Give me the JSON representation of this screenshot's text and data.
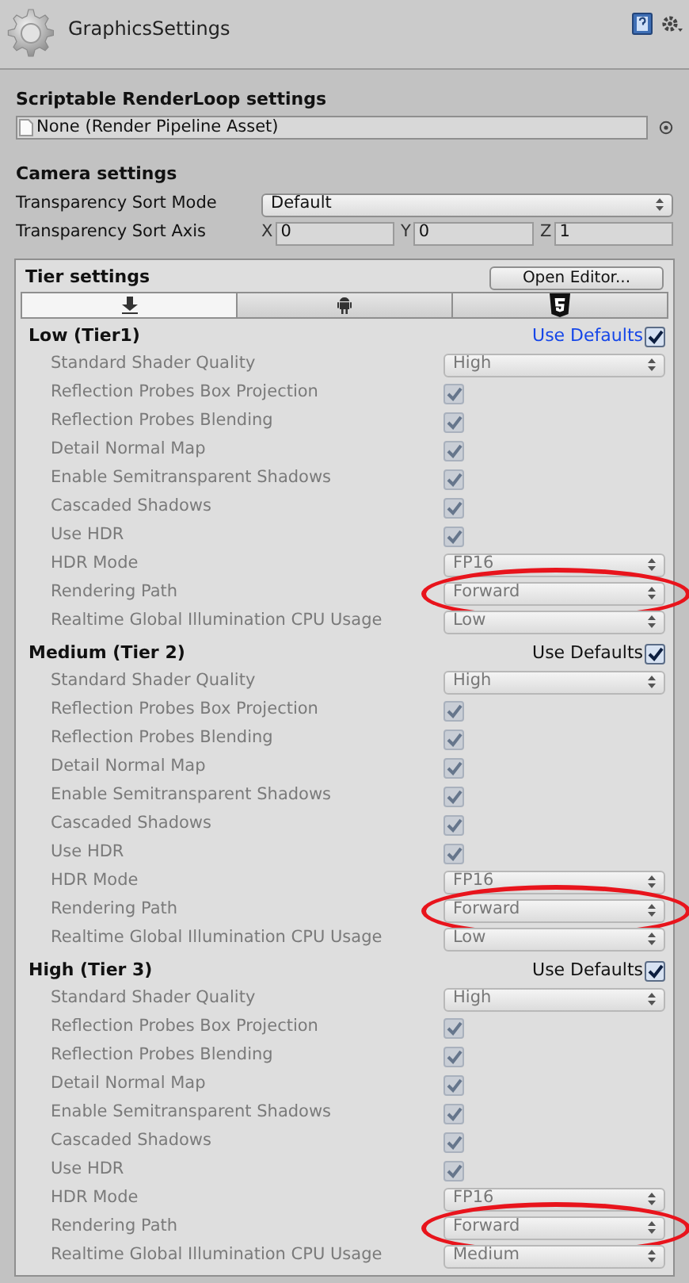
{
  "header": {
    "title": "GraphicsSettings"
  },
  "scriptable": {
    "heading": "Scriptable RenderLoop settings",
    "field": "None (Render Pipeline Asset)"
  },
  "camera": {
    "heading": "Camera settings",
    "sort_mode": {
      "label": "Transparency Sort Mode",
      "value": "Default"
    },
    "sort_axis": {
      "label": "Transparency Sort Axis",
      "axes": [
        {
          "label": "X",
          "value": "0"
        },
        {
          "label": "Y",
          "value": "0"
        },
        {
          "label": "Z",
          "value": "1"
        }
      ]
    }
  },
  "tier_settings": {
    "heading": "Tier settings",
    "button": "Open Editor...",
    "tabs": [
      {
        "kind": "download",
        "selected": true
      },
      {
        "kind": "android",
        "selected": false
      },
      {
        "kind": "html5",
        "selected": false
      }
    ],
    "tiers": [
      {
        "name": "Low (Tier1)",
        "defaults_label": "Use Defaults",
        "use_defaults": true,
        "highlighted": true,
        "settings": [
          {
            "kind": "dropdown",
            "label": "Standard Shader Quality",
            "value": "High",
            "circled": false
          },
          {
            "kind": "checkbox",
            "label": "Reflection Probes Box Projection",
            "checked": true
          },
          {
            "kind": "checkbox",
            "label": "Reflection Probes Blending",
            "checked": true
          },
          {
            "kind": "checkbox",
            "label": "Detail Normal Map",
            "checked": true
          },
          {
            "kind": "checkbox",
            "label": "Enable Semitransparent Shadows",
            "checked": true
          },
          {
            "kind": "checkbox",
            "label": "Cascaded Shadows",
            "checked": true
          },
          {
            "kind": "checkbox",
            "label": "Use HDR",
            "checked": true
          },
          {
            "kind": "dropdown",
            "label": "HDR Mode",
            "value": "FP16",
            "circled": false
          },
          {
            "kind": "dropdown",
            "label": "Rendering Path",
            "value": "Forward",
            "circled": true
          },
          {
            "kind": "dropdown",
            "label": "Realtime Global Illumination CPU Usage",
            "value": "Low",
            "circled": false
          }
        ]
      },
      {
        "name": "Medium (Tier 2)",
        "defaults_label": "Use Defaults",
        "use_defaults": true,
        "highlighted": false,
        "settings": [
          {
            "kind": "dropdown",
            "label": "Standard Shader Quality",
            "value": "High",
            "circled": false
          },
          {
            "kind": "checkbox",
            "label": "Reflection Probes Box Projection",
            "checked": true
          },
          {
            "kind": "checkbox",
            "label": "Reflection Probes Blending",
            "checked": true
          },
          {
            "kind": "checkbox",
            "label": "Detail Normal Map",
            "checked": true
          },
          {
            "kind": "checkbox",
            "label": "Enable Semitransparent Shadows",
            "checked": true
          },
          {
            "kind": "checkbox",
            "label": "Cascaded Shadows",
            "checked": true
          },
          {
            "kind": "checkbox",
            "label": "Use HDR",
            "checked": true
          },
          {
            "kind": "dropdown",
            "label": "HDR Mode",
            "value": "FP16",
            "circled": false
          },
          {
            "kind": "dropdown",
            "label": "Rendering Path",
            "value": "Forward",
            "circled": true
          },
          {
            "kind": "dropdown",
            "label": "Realtime Global Illumination CPU Usage",
            "value": "Low",
            "circled": false
          }
        ]
      },
      {
        "name": "High (Tier 3)",
        "defaults_label": "Use Defaults",
        "use_defaults": true,
        "highlighted": false,
        "settings": [
          {
            "kind": "dropdown",
            "label": "Standard Shader Quality",
            "value": "High",
            "circled": false
          },
          {
            "kind": "checkbox",
            "label": "Reflection Probes Box Projection",
            "checked": true
          },
          {
            "kind": "checkbox",
            "label": "Reflection Probes Blending",
            "checked": true
          },
          {
            "kind": "checkbox",
            "label": "Detail Normal Map",
            "checked": true
          },
          {
            "kind": "checkbox",
            "label": "Enable Semitransparent Shadows",
            "checked": true
          },
          {
            "kind": "checkbox",
            "label": "Cascaded Shadows",
            "checked": true
          },
          {
            "kind": "checkbox",
            "label": "Use HDR",
            "checked": true
          },
          {
            "kind": "dropdown",
            "label": "HDR Mode",
            "value": "FP16",
            "circled": false
          },
          {
            "kind": "dropdown",
            "label": "Rendering Path",
            "value": "Forward",
            "circled": true
          },
          {
            "kind": "dropdown",
            "label": "Realtime Global Illumination CPU Usage",
            "value": "Medium",
            "circled": false
          }
        ]
      }
    ]
  }
}
